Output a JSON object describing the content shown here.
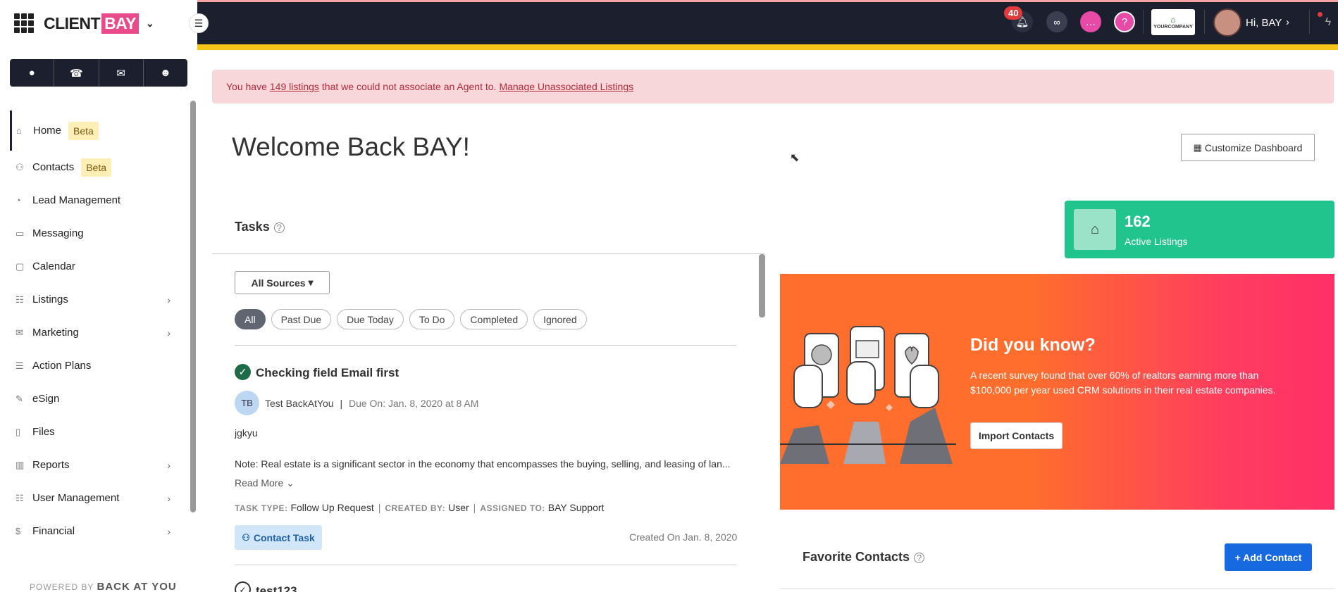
{
  "brand": {
    "client": "CLIENT",
    "bay": "BAY"
  },
  "quick_actions": [
    {
      "name": "chat-icon",
      "glyph": "💬"
    },
    {
      "name": "phone-icon",
      "glyph": "📞"
    },
    {
      "name": "mail-icon",
      "glyph": "✉"
    },
    {
      "name": "add-user-icon",
      "glyph": "👤+"
    }
  ],
  "sidebar": {
    "items": [
      {
        "label": "Home",
        "badge": "Beta",
        "icon": "home-icon"
      },
      {
        "label": "Contacts",
        "badge": "Beta",
        "icon": "contacts-icon"
      },
      {
        "label": "Lead Management",
        "icon": "pie-icon"
      },
      {
        "label": "Messaging",
        "icon": "message-icon"
      },
      {
        "label": "Calendar",
        "icon": "calendar-icon"
      },
      {
        "label": "Listings",
        "icon": "listings-icon"
      },
      {
        "label": "Marketing",
        "icon": "mail-icon"
      },
      {
        "label": "Action Plans",
        "icon": "plans-icon"
      },
      {
        "label": "eSign",
        "icon": "pen-icon"
      },
      {
        "label": "Files",
        "icon": "file-icon"
      },
      {
        "label": "Reports",
        "icon": "chart-icon"
      },
      {
        "label": "User Management",
        "icon": "users-icon"
      },
      {
        "label": "Financial",
        "icon": "dollar-icon"
      }
    ],
    "powered_prefix": "POWERED BY",
    "powered_brand": "BACK AT YOU"
  },
  "topbar": {
    "notification_count": "40",
    "company_logo": "YOURCOMPANY",
    "greeting": "Hi, BAY"
  },
  "alert": {
    "prefix": "You have",
    "listings_link": "149 listings",
    "middle": "that we could not associate an Agent to.",
    "manage_link": "Manage Unassociated Listings"
  },
  "welcome": "Welcome Back BAY!",
  "customize_label": "Customize Dashboard",
  "tasks": {
    "title": "Tasks",
    "source_filter": "All Sources",
    "filters": [
      "All",
      "Past Due",
      "Due Today",
      "To Do",
      "Completed",
      "Ignored"
    ],
    "active_filter": "All",
    "items": [
      {
        "title": "Checking field Email first",
        "initials": "TB",
        "contact": "Test BackAtYou",
        "due": "Due On: Jan. 8, 2020 at 8 AM",
        "description": "jgkyu",
        "note_label": "Note:",
        "note": "Real estate is a significant sector in the economy that encompasses the buying, selling, and leasing of lan...",
        "read_more": "Read More",
        "type_key": "TASK TYPE:",
        "type_val": "Follow Up Request",
        "created_by_key": "CREATED BY:",
        "created_by_val": "User",
        "assigned_key": "ASSIGNED TO:",
        "assigned_val": "BAY Support",
        "tag": "Contact Task",
        "created_on": "Created On Jan. 8, 2020"
      },
      {
        "title": "test123"
      }
    ]
  },
  "listings_card": {
    "count": "162",
    "label": "Active Listings"
  },
  "promo": {
    "title": "Did you know?",
    "text": "A recent survey found that over 60% of realtors earning more than $100,000 per year used CRM solutions in their real estate companies.",
    "button": "Import Contacts"
  },
  "favorites": {
    "title": "Favorite Contacts",
    "add_button": "+ Add Contact"
  },
  "colors": {
    "dark": "#1c1f2e",
    "accent_yellow": "#f5c518",
    "green": "#21c48d",
    "brand_pink": "#e84a8a",
    "primary_blue": "#1769e0"
  }
}
